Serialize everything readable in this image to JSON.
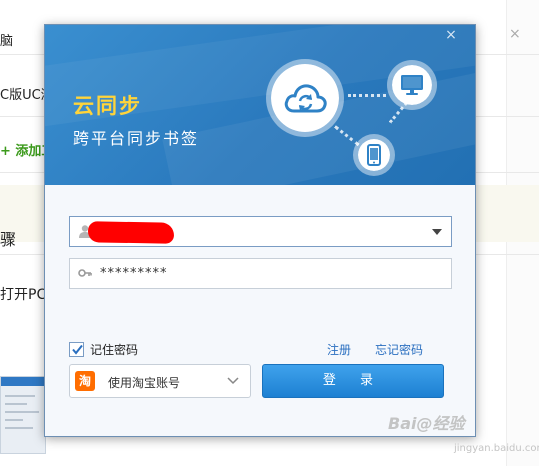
{
  "background": {
    "rows": [
      "脑",
      "C版UC浏",
      "+ 添加工",
      "骤",
      "打开PC"
    ]
  },
  "dialog": {
    "close_glyph": "×",
    "banner": {
      "title": "云同步",
      "subtitle": "跨平台同步书签"
    },
    "username": {
      "value": ""
    },
    "password": {
      "value": "*********"
    },
    "remember": {
      "label": "记住密码",
      "checked": true
    },
    "register_link": "注册",
    "forgot_link": "忘记密码",
    "taobao": {
      "logo_char": "淘",
      "label": "使用淘宝账号"
    },
    "login_button": "登 录"
  },
  "watermark": {
    "text": "Bai@经验",
    "sub": "jingyan.baidu.com"
  },
  "colors": {
    "banner": "#2a79bd",
    "title_yellow": "#ffd43a",
    "link_blue": "#2a6fc0",
    "button_blue": "#1d80d2",
    "taobao_orange": "#ff6d00",
    "redaction_red": "#ff0000"
  },
  "icons": [
    "cloud-sync-icon",
    "monitor-icon",
    "phone-icon",
    "user-icon",
    "key-icon",
    "dropdown-arrow-icon",
    "chevron-down-icon",
    "checkmark-icon",
    "close-icon"
  ]
}
